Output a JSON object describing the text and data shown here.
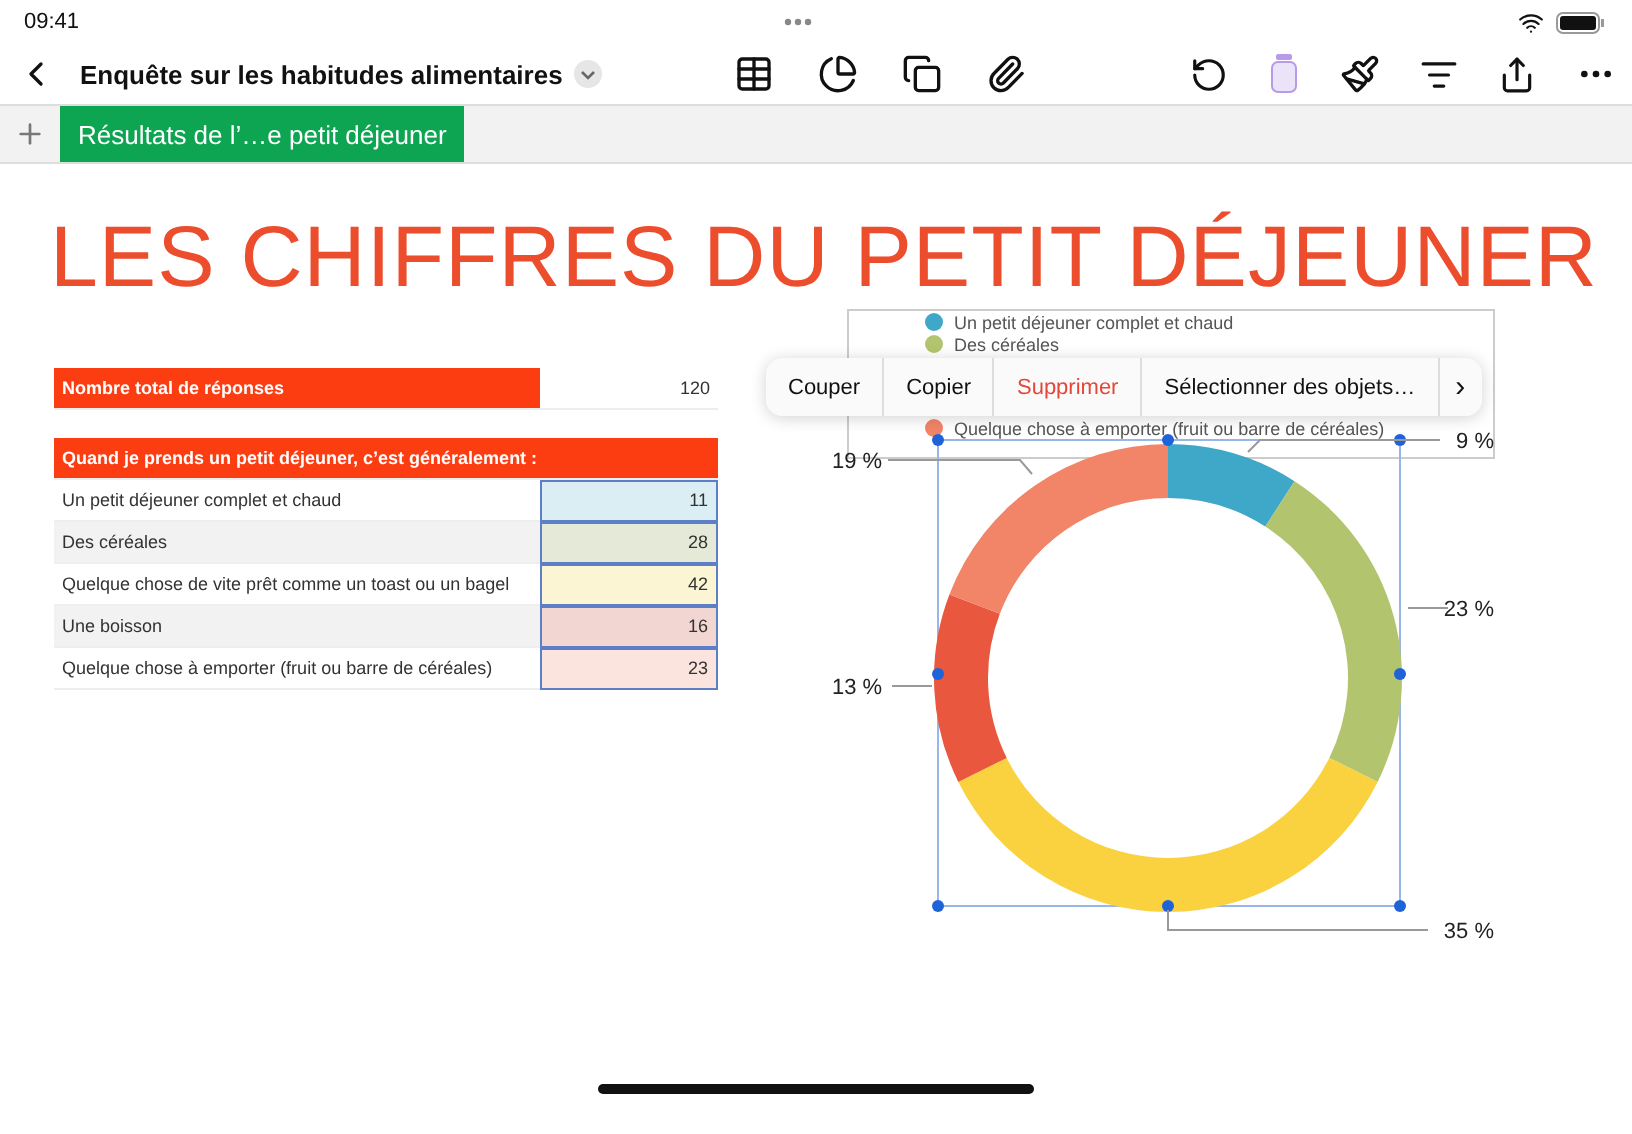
{
  "status_bar": {
    "time": "09:41"
  },
  "toolbar": {
    "title": "Enquête sur les habitudes alimentaires"
  },
  "sheet_tabs": [
    {
      "label": "Résultats de l’…e petit déjeuner",
      "selected": true
    }
  ],
  "title": "LES CHIFFRES DU PETIT DÉJEUNER",
  "total_table": {
    "label": "Nombre total de réponses",
    "value": "120"
  },
  "answers_table": {
    "header": "Quand je prends un petit déjeuner, c’est généralement :",
    "rows": [
      {
        "label": "Un petit déjeuner complet et chaud",
        "value": "11",
        "color": "#dbeef4"
      },
      {
        "label": "Des céréales",
        "value": "28",
        "color": "#e5ead8"
      },
      {
        "label": "Quelque chose de vite prêt comme un toast ou un bagel",
        "value": "42",
        "color": "#fcf5d4"
      },
      {
        "label": "Une boisson",
        "value": "16",
        "color": "#f1d6d1"
      },
      {
        "label": "Quelque chose à emporter (fruit ou barre de céréales)",
        "value": "23",
        "color": "#fbe3de"
      }
    ]
  },
  "chart": {
    "legend": [
      {
        "label": "Un petit déjeuner complet et chaud",
        "color": "#3fa8c8"
      },
      {
        "label": "Des céréales",
        "color": "#b2c56e"
      },
      {
        "label": "Quelque chose à emporter (fruit ou barre de céréales)",
        "color": "#f28468"
      }
    ],
    "chart_data": {
      "type": "donut",
      "values": [
        9,
        23,
        35,
        13,
        19
      ],
      "colors": [
        "#3fa8c8",
        "#b2c56e",
        "#fad23f",
        "#e9583e",
        "#f28468"
      ],
      "value_labels": [
        "9 %",
        "23 %",
        "35 %",
        "13 %",
        "19 %"
      ]
    }
  },
  "context_menu": [
    {
      "label": "Couper",
      "kind": "action"
    },
    {
      "label": "Copier",
      "kind": "action"
    },
    {
      "label": "Supprimer",
      "kind": "destructive"
    },
    {
      "label": "Sélectionner des objets…",
      "kind": "action"
    },
    {
      "label": "›",
      "kind": "more"
    }
  ]
}
